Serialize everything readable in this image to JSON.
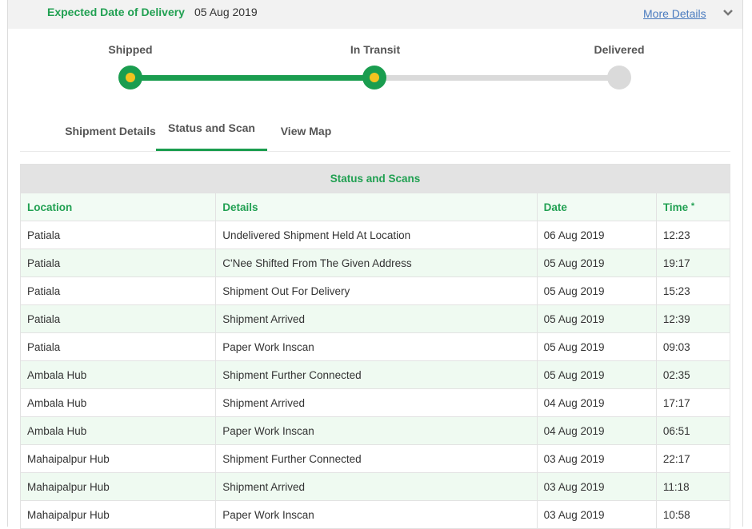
{
  "header": {
    "edd_label": "Expected Date of Delivery",
    "edd_value": "05 Aug 2019",
    "more_details": "More Details"
  },
  "progress": {
    "steps": [
      {
        "label": "Shipped",
        "done": true
      },
      {
        "label": "In Transit",
        "done": true
      },
      {
        "label": "Delivered",
        "done": false
      }
    ],
    "colors": {
      "done": "#1a9d4f",
      "pending": "#dadada",
      "dot": "#f4c320"
    }
  },
  "tabs": [
    {
      "label": "Shipment Details",
      "active": false
    },
    {
      "label": "Status and Scan",
      "active": true
    },
    {
      "label": "View Map",
      "active": false
    }
  ],
  "table": {
    "caption": "Status and Scans",
    "columns": [
      "Location",
      "Details",
      "Date",
      "Time"
    ],
    "time_marker": "*",
    "rows": [
      [
        "Patiala",
        "Undelivered Shipment Held At Location",
        "06 Aug 2019",
        "12:23"
      ],
      [
        "Patiala",
        "C'Nee Shifted From The Given Address",
        "05 Aug 2019",
        "19:17"
      ],
      [
        "Patiala",
        "Shipment Out For Delivery",
        "05 Aug 2019",
        "15:23"
      ],
      [
        "Patiala",
        "Shipment Arrived",
        "05 Aug 2019",
        "12:39"
      ],
      [
        "Patiala",
        "Paper Work Inscan",
        "05 Aug 2019",
        "09:03"
      ],
      [
        "Ambala Hub",
        "Shipment Further Connected",
        "05 Aug 2019",
        "02:35"
      ],
      [
        "Ambala Hub",
        "Shipment Arrived",
        "04 Aug 2019",
        "17:17"
      ],
      [
        "Ambala Hub",
        "Paper Work Inscan",
        "04 Aug 2019",
        "06:51"
      ],
      [
        "Mahaipalpur Hub",
        "Shipment Further Connected",
        "03 Aug 2019",
        "22:17"
      ],
      [
        "Mahaipalpur Hub",
        "Shipment Arrived",
        "03 Aug 2019",
        "11:18"
      ],
      [
        "Mahaipalpur Hub",
        "Paper Work Inscan",
        "03 Aug 2019",
        "10:58"
      ]
    ]
  }
}
